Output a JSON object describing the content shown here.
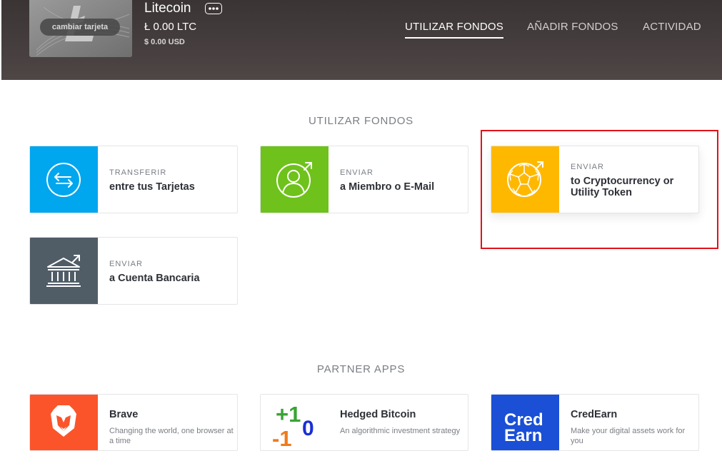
{
  "header": {
    "change_card": "cambiar tarjeta",
    "coin_name": "Litecoin",
    "balance_ltc": "Ł 0.00 LTC",
    "balance_usd": "$ 0.00 USD",
    "nav": {
      "spend": "UTILIZAR FONDOS",
      "add": "AÑADIR FONDOS",
      "activity": "ACTIVIDAD"
    }
  },
  "spend_section": {
    "title": "UTILIZAR FONDOS",
    "tiles": [
      {
        "kicker": "TRANSFERIR",
        "label": "entre tus Tarjetas",
        "color": "#00a6ee"
      },
      {
        "kicker": "ENVIAR",
        "label": "a Miembro o E-Mail",
        "color": "#6ec21b"
      },
      {
        "kicker": "ENVIAR",
        "label": "to Cryptocurrency or Utility Token",
        "color": "#ffb800"
      },
      {
        "kicker": "ENVIAR",
        "label": "a Cuenta Bancaria",
        "color": "#505d67"
      }
    ]
  },
  "partner_section": {
    "title": "PARTNER APPS",
    "apps": [
      {
        "name": "Brave",
        "desc": "Changing the world, one browser at a time",
        "color": "#fb542b"
      },
      {
        "name": "Hedged Bitcoin",
        "desc": "An algorithmic investment strategy",
        "logo_text_a": "+1",
        "logo_text_b": "0",
        "logo_text_c": "-1"
      },
      {
        "name": "CredEarn",
        "desc": "Make your digital assets work for you",
        "color": "#1a4fd6",
        "logo_line1": "Cred",
        "logo_line2": "Earn"
      }
    ]
  }
}
